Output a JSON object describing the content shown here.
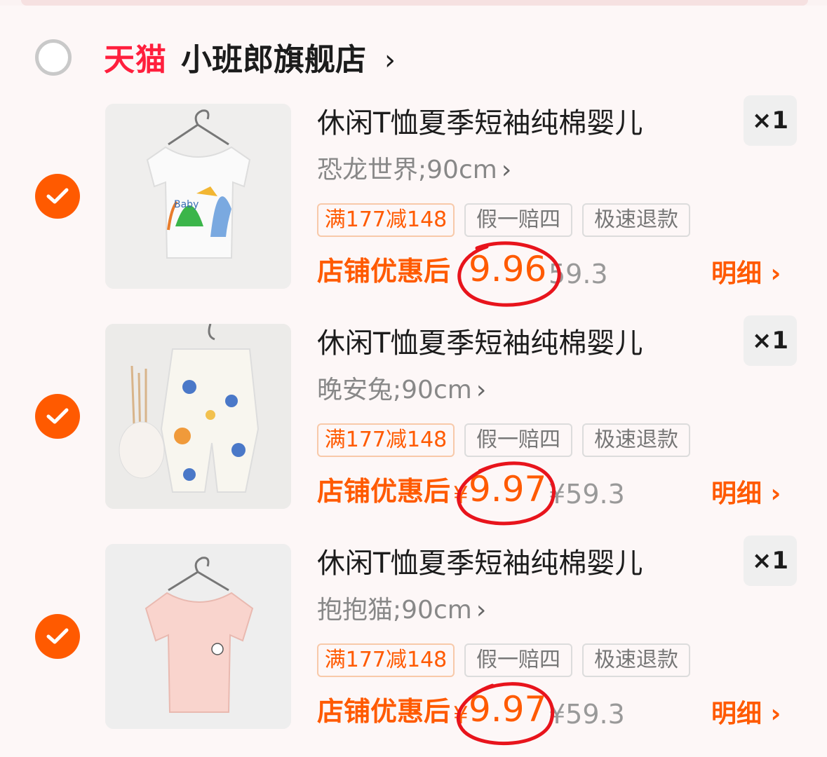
{
  "store": {
    "platform_badge": "天猫",
    "name": "小班郎旗舰店",
    "chevron": "›"
  },
  "items": [
    {
      "title": "休闲T恤夏季短袖纯棉婴儿",
      "spec": "恐龙世界;90cm",
      "quantity": "×1",
      "tags": [
        "满177减148",
        "假一赔四",
        "极速退款"
      ],
      "price_label": "店铺优惠后",
      "currency": "¥",
      "price": "9.96",
      "original_price": "59.3",
      "detail": "明细 ›"
    },
    {
      "title": "休闲T恤夏季短袖纯棉婴儿",
      "spec": "晚安兔;90cm",
      "quantity": "×1",
      "tags": [
        "满177减148",
        "假一赔四",
        "极速退款"
      ],
      "price_label": "店铺优惠后",
      "currency": "¥",
      "price": "9.97",
      "original_price": "¥59.3",
      "detail": "明细 ›"
    },
    {
      "title": "休闲T恤夏季短袖纯棉婴儿",
      "spec": "抱抱猫;90cm",
      "quantity": "×1",
      "tags": [
        "满177减148",
        "假一赔四",
        "极速退款"
      ],
      "price_label": "店铺优惠后",
      "currency": "¥",
      "price": "9.97",
      "original_price": "¥59.3",
      "detail": "明细 ›"
    }
  ],
  "colors": {
    "accent": "#ff5a00",
    "tmall_red": "#ff1f3d",
    "annotation_red": "#e8141c"
  }
}
